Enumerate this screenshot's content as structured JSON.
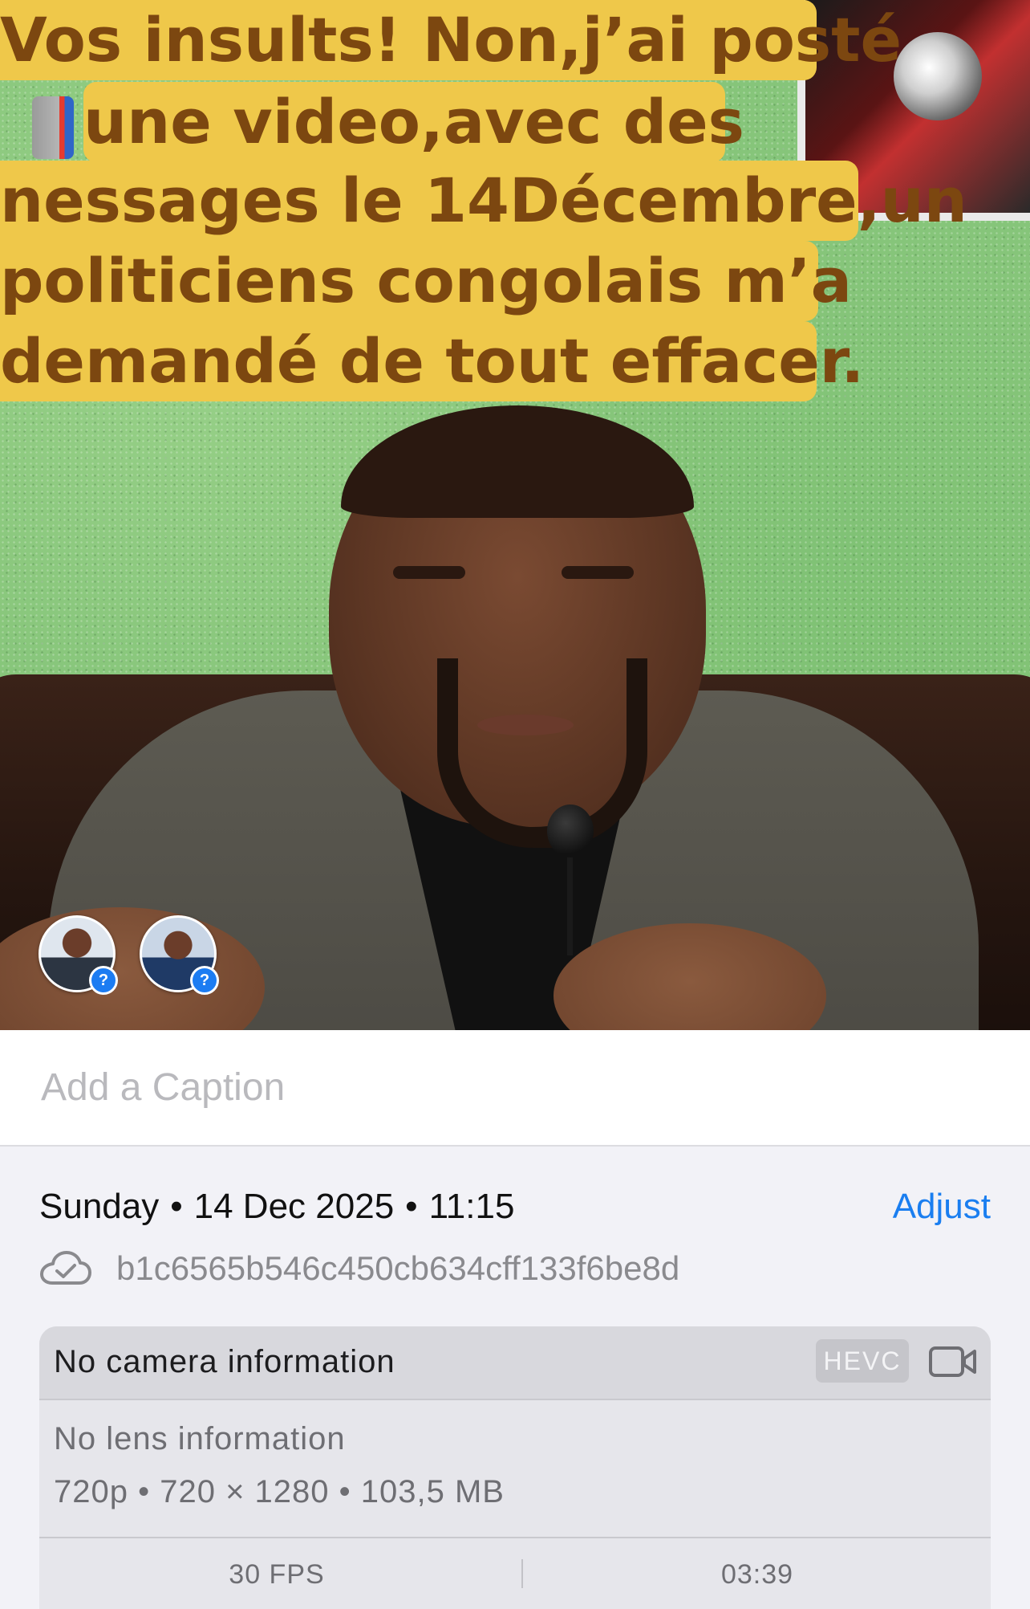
{
  "video": {
    "overlay_lines": [
      "Vos insults! Non,j’ai posté",
      "une video,avec des",
      "nessages le 14Décembre,un",
      "politiciens congolais m’a",
      "demandé de tout effacer."
    ],
    "people_badges": [
      "?",
      "?"
    ]
  },
  "caption": {
    "placeholder": "Add a Caption"
  },
  "info": {
    "day": "Sunday",
    "date": "14 Dec 2025",
    "time": "11:15",
    "adjust_label": "Adjust",
    "cloud_icon": "icloud-check-icon",
    "file_name": "b1c6565b546c450cb634cff133f6be8d"
  },
  "media_card": {
    "camera_info": "No camera information",
    "codec_badge": "HEVC",
    "video_icon": "video-camera-icon",
    "lens_info": "No lens information",
    "specs": "720p • 720 × 1280 • 103,5 MB",
    "fps": "30 FPS",
    "duration": "03:39"
  },
  "colors": {
    "accent": "#1a7ef0",
    "overlay_bg": "#efc84a",
    "overlay_text": "#7c4710"
  }
}
